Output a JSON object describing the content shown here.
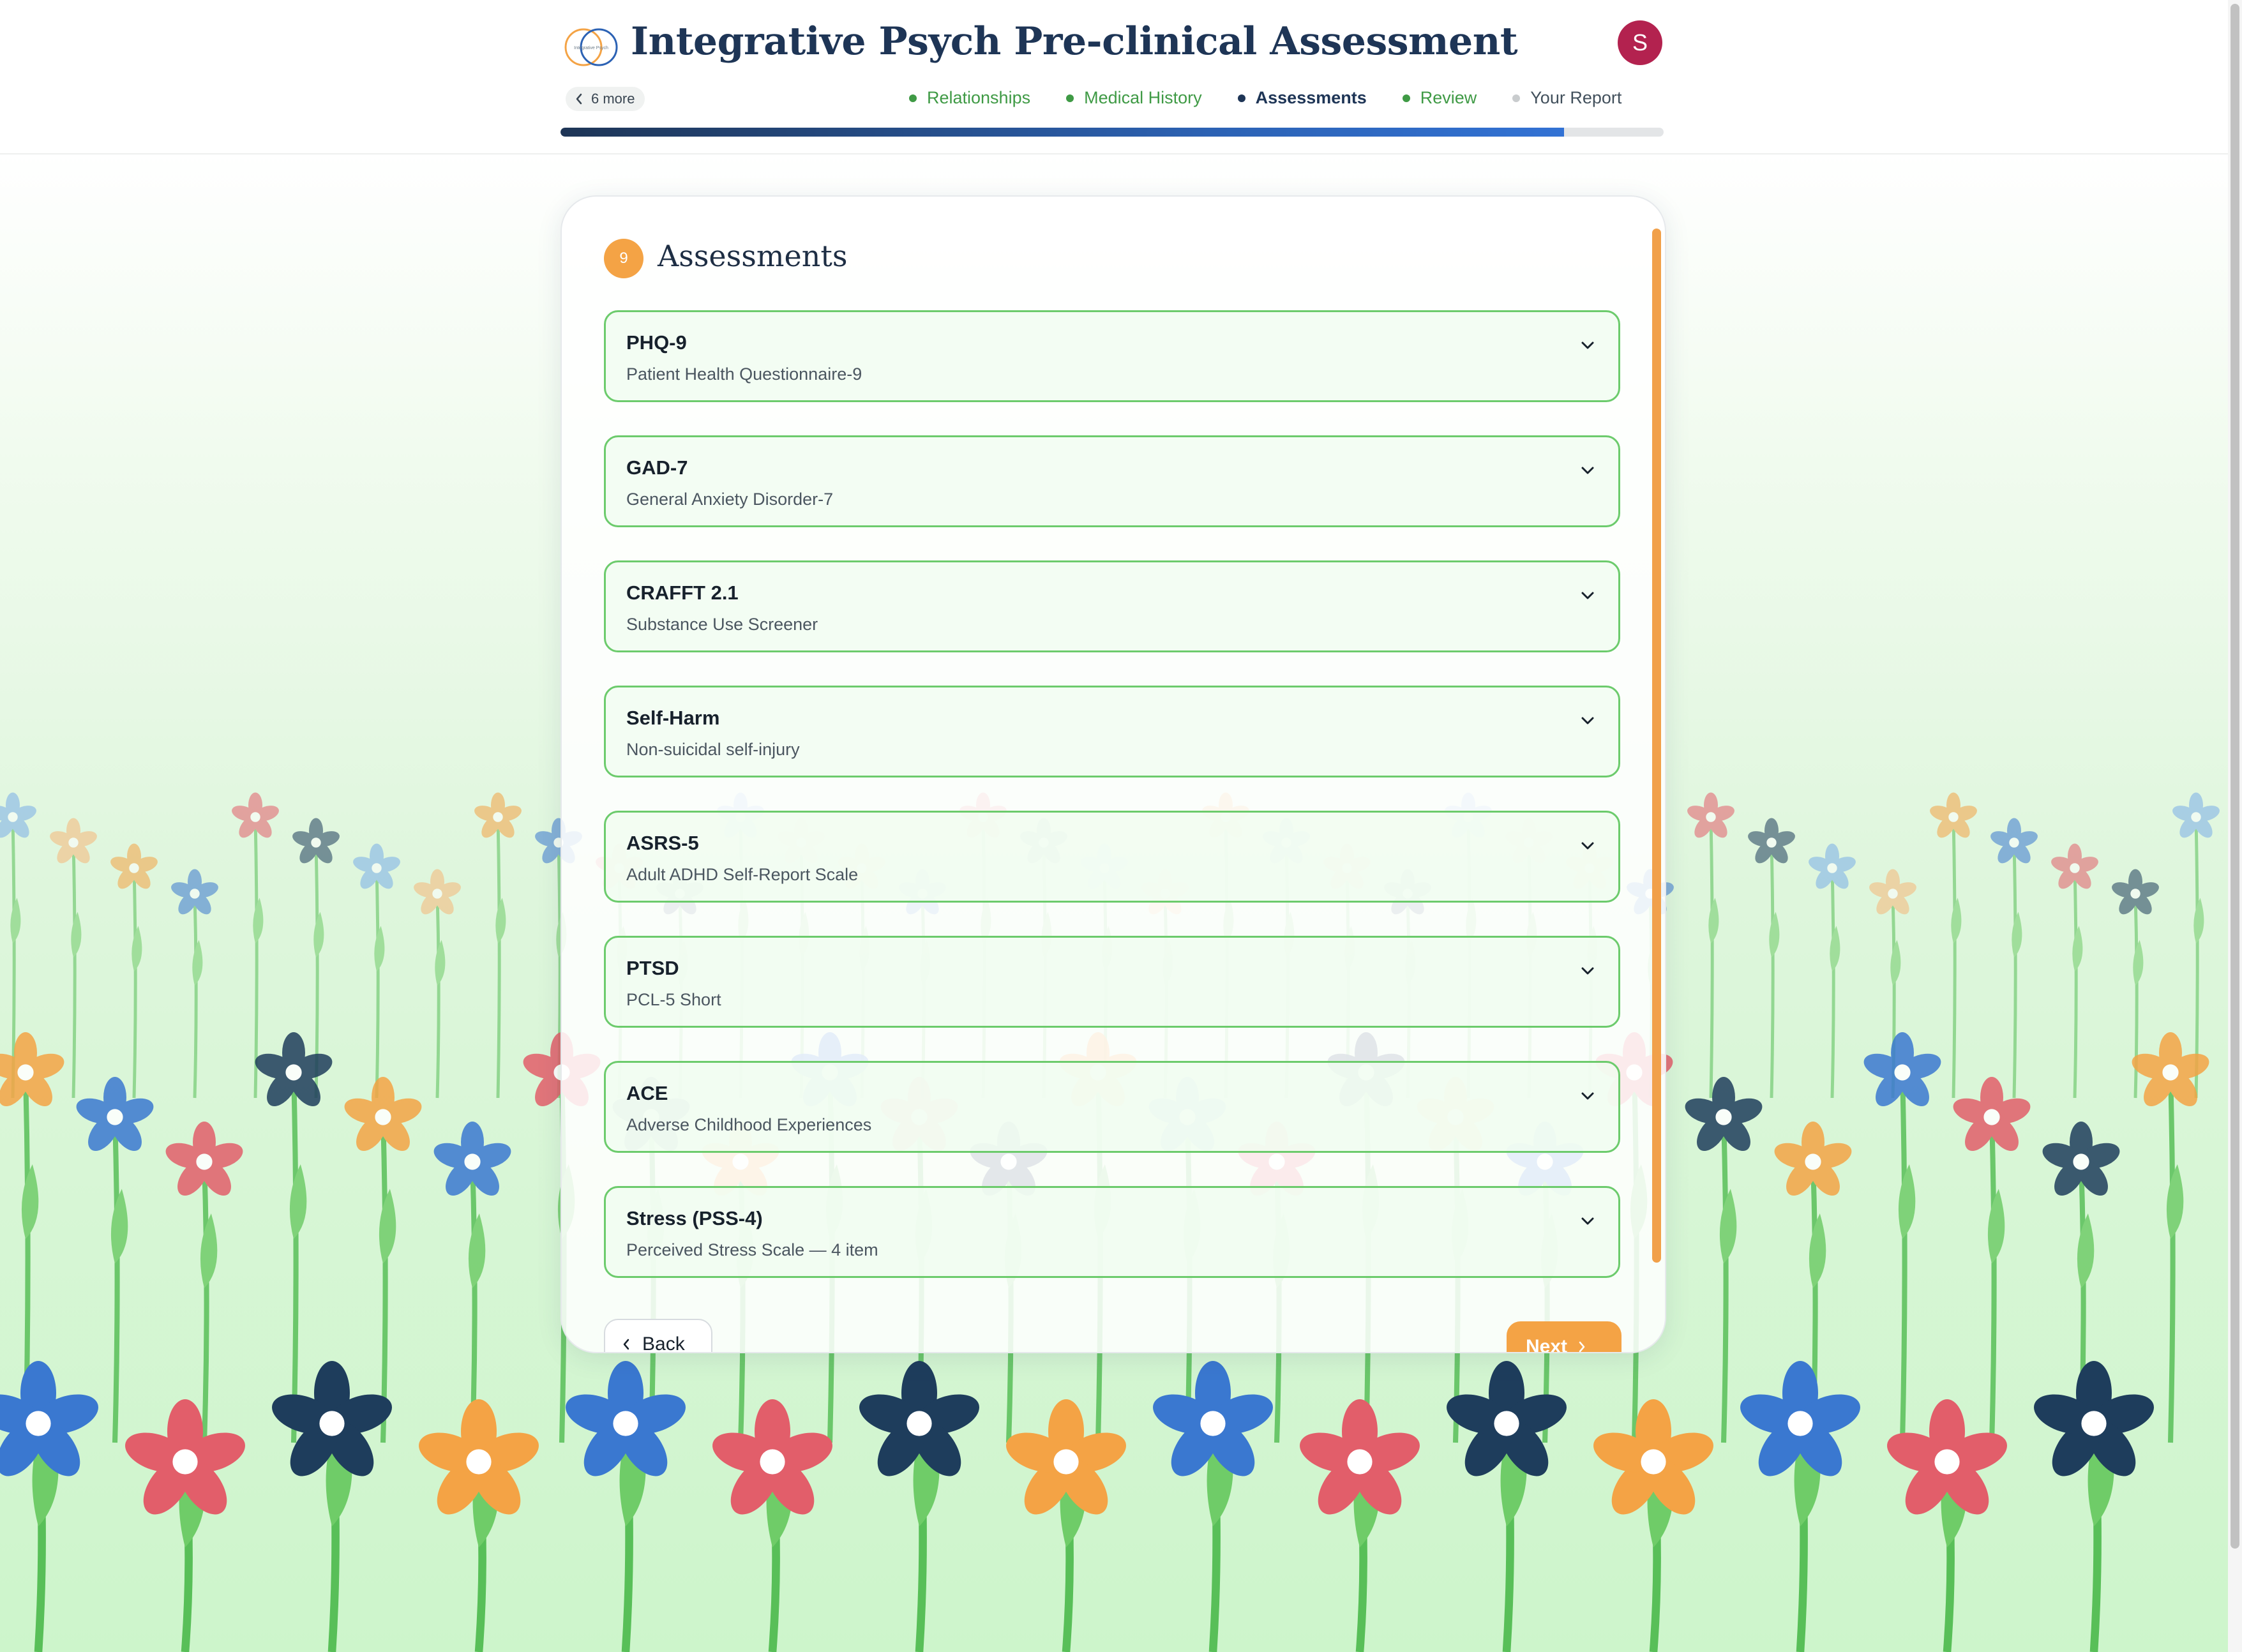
{
  "header": {
    "title": "Integrative Psych Pre-clinical Assessment",
    "logo_text": "Integrative Psych",
    "avatar_initial": "S",
    "more_label": "6 more",
    "steps": [
      {
        "label": "Relationships",
        "state": "done"
      },
      {
        "label": "Medical History",
        "state": "done"
      },
      {
        "label": "Assessments",
        "state": "active"
      },
      {
        "label": "Review",
        "state": "done"
      },
      {
        "label": "Your Report",
        "state": "todo"
      }
    ],
    "progress_fraction": 0.91
  },
  "section": {
    "number": "9",
    "title": "Assessments"
  },
  "assessments": [
    {
      "name": "PHQ-9",
      "description": "Patient Health Questionnaire-9"
    },
    {
      "name": "GAD-7",
      "description": "General Anxiety Disorder-7"
    },
    {
      "name": "CRAFFT 2.1",
      "description": "Substance Use Screener"
    },
    {
      "name": "Self-Harm",
      "description": "Non-suicidal self-injury"
    },
    {
      "name": "ASRS-5",
      "description": "Adult ADHD Self-Report Scale"
    },
    {
      "name": "PTSD",
      "description": "PCL-5 Short"
    },
    {
      "name": "ACE",
      "description": "Adverse Childhood Experiences"
    },
    {
      "name": "Stress (PSS-4)",
      "description": "Perceived Stress Scale — 4 item"
    }
  ],
  "nav": {
    "back_label": "Back",
    "next_label": "Next"
  },
  "colors": {
    "brand_navy": "#1e3556",
    "accent_orange": "#f4a345",
    "done_green": "#3f9a45",
    "avatar": "#b3224f",
    "card_border_green": "#6ccb6c"
  }
}
